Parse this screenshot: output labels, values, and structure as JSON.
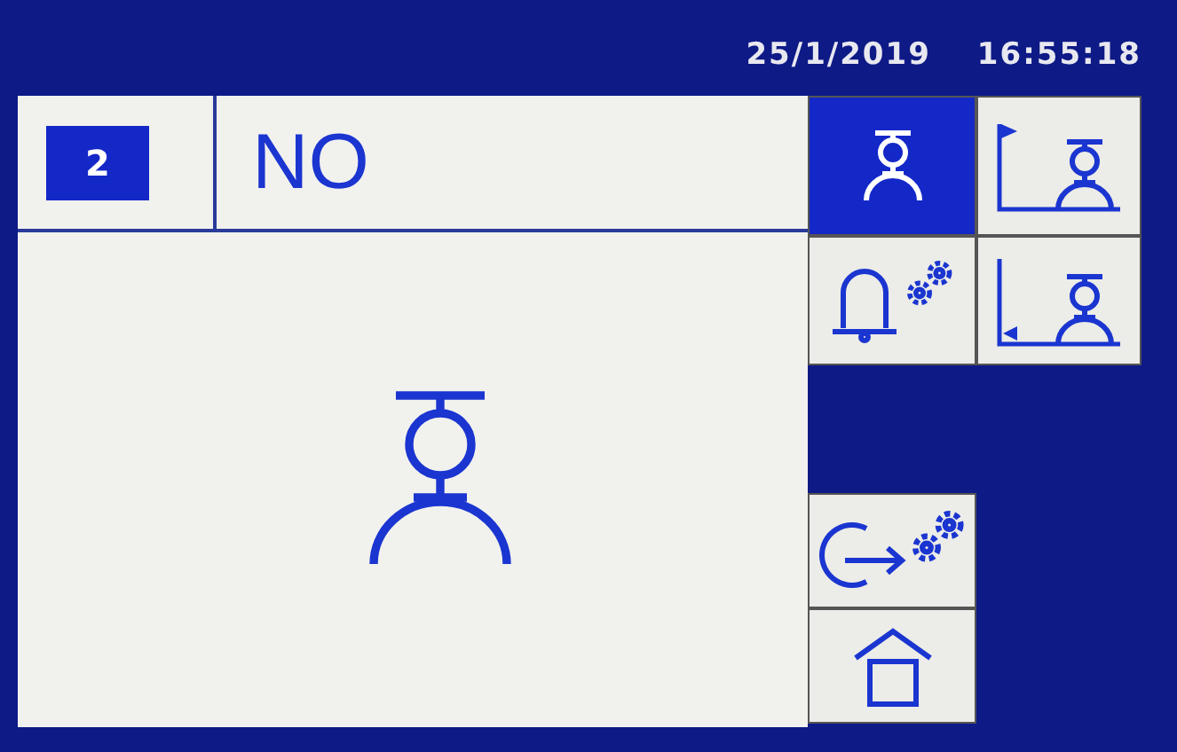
{
  "status_bar": {
    "date": "25/1/2019",
    "time": "16:55:18"
  },
  "station": {
    "number": "2",
    "status": "NO"
  },
  "buttons": [
    {
      "kind": "operator",
      "selected": true
    },
    {
      "kind": "operator-start",
      "selected": false
    },
    {
      "kind": "alarm-settings",
      "selected": false
    },
    {
      "kind": "operator-end",
      "selected": false
    },
    {
      "kind": "exit-settings",
      "selected": false
    },
    {
      "kind": "home",
      "selected": false
    }
  ]
}
